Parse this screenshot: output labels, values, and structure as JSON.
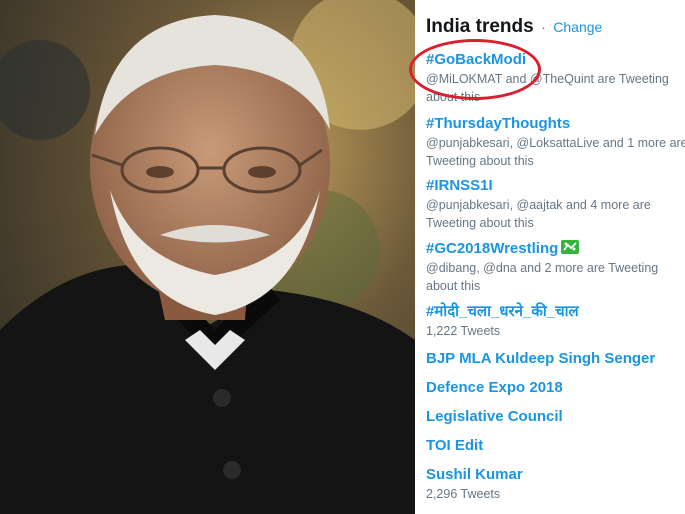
{
  "header": {
    "title": "India trends",
    "separator": "·",
    "change_label": "Change"
  },
  "trends": [
    {
      "name": "#GoBackModi",
      "meta": "@MiLOKMAT and @TheQuint are Tweeting about this"
    },
    {
      "name": "#ThursdayThoughts",
      "meta": "@punjabkesari, @LoksattaLive and 1 more are Tweeting about this"
    },
    {
      "name": "#IRNSS1I",
      "meta": "@punjabkesari, @aajtak and 4 more are Tweeting about this"
    },
    {
      "name": "#GC2018Wrestling",
      "meta": "@dibang, @dna and 2 more are Tweeting about this",
      "icon": "wrestling-emoji-icon"
    },
    {
      "name": "#मोदी_चला_धरने_की_चाल",
      "meta": "1,222 Tweets"
    },
    {
      "name": "BJP MLA Kuldeep Singh Senger",
      "meta": ""
    },
    {
      "name": "Defence Expo 2018",
      "meta": ""
    },
    {
      "name": "Legislative Council",
      "meta": ""
    },
    {
      "name": "TOI Edit",
      "meta": ""
    },
    {
      "name": "Sushil Kumar",
      "meta": "2,296 Tweets"
    }
  ],
  "highlight": {
    "color": "#d8202f",
    "target": "#GoBackModi"
  },
  "colors": {
    "link": "#1b95e0",
    "meta": "#657786",
    "title": "#14171a"
  }
}
